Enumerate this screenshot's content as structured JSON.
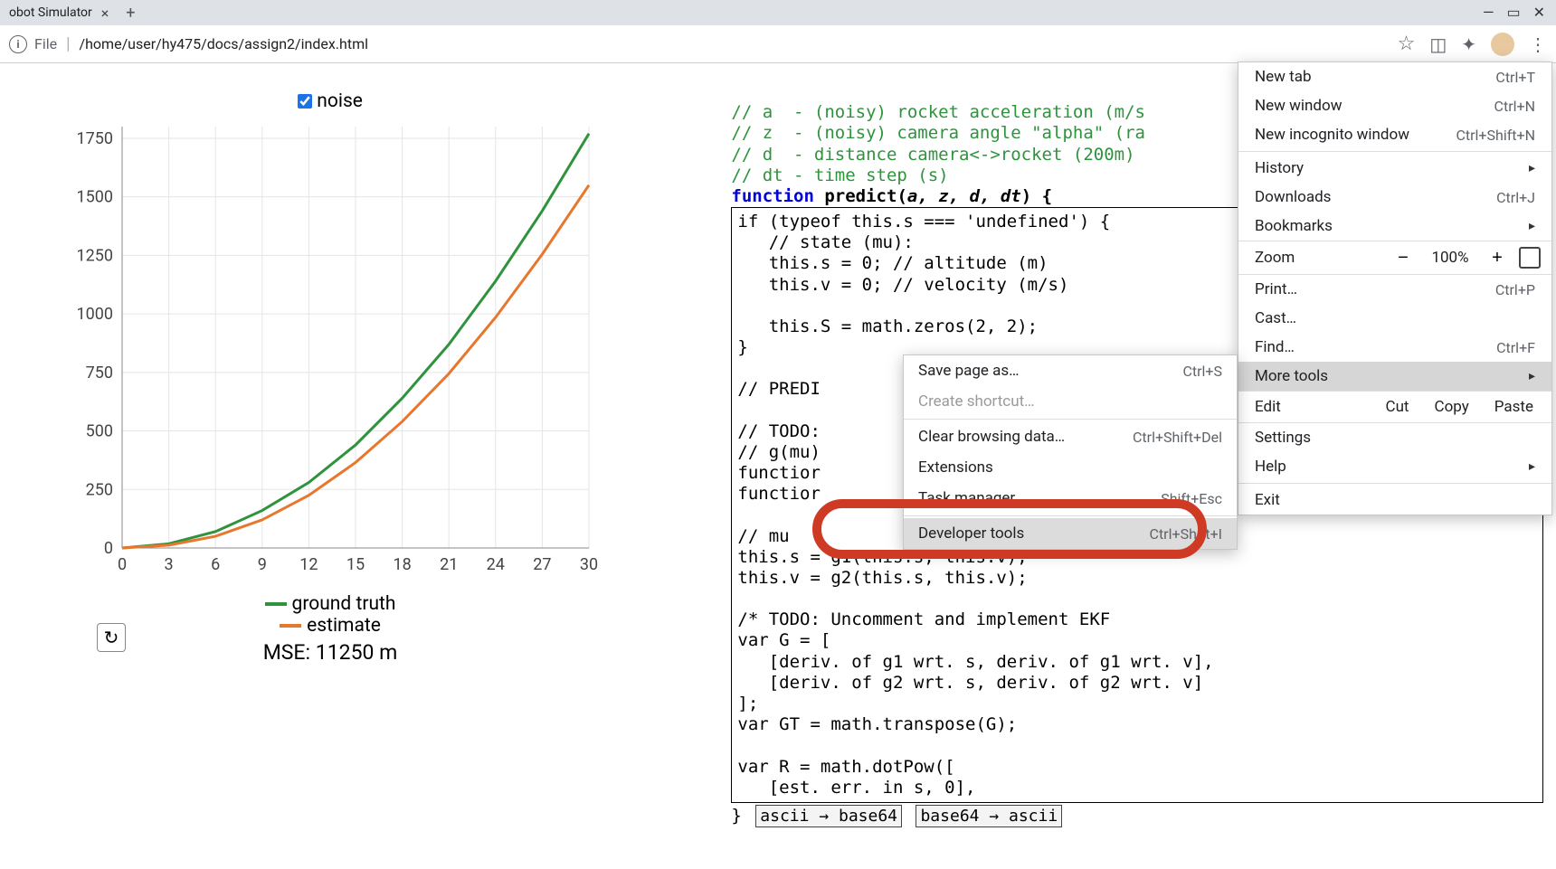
{
  "tab": {
    "title": "obot Simulator"
  },
  "addr": {
    "scheme": "File",
    "path": "/home/user/hy475/docs/assign2/index.html"
  },
  "chart_data": {
    "type": "line",
    "title": "",
    "xlabel": "",
    "ylabel": "",
    "xlim": [
      0,
      30
    ],
    "ylim": [
      0,
      1800
    ],
    "xticks": [
      0,
      3,
      6,
      9,
      12,
      15,
      18,
      21,
      24,
      27,
      30
    ],
    "yticks": [
      0,
      250,
      500,
      750,
      1000,
      1250,
      1500,
      1750
    ],
    "series": [
      {
        "name": "ground truth",
        "color": "#2e933c",
        "x": [
          0,
          3,
          6,
          9,
          12,
          15,
          18,
          21,
          24,
          27,
          30
        ],
        "y": [
          0,
          18,
          70,
          160,
          280,
          440,
          640,
          870,
          1140,
          1440,
          1770
        ]
      },
      {
        "name": "estimate",
        "color": "#e8772e",
        "x": [
          0,
          3,
          6,
          9,
          12,
          15,
          18,
          21,
          24,
          27,
          30
        ],
        "y": [
          0,
          12,
          50,
          120,
          225,
          365,
          540,
          745,
          985,
          1255,
          1550
        ]
      }
    ],
    "toggle_label": "noise",
    "toggle_checked": true,
    "mse_label": "MSE:",
    "mse_value": "11250 m"
  },
  "code_header": [
    "// a  - (noisy) rocket acceleration (m/s",
    "// z  - (noisy) camera angle \"alpha\" (ra",
    "// d  - distance camera<->rocket (200m)",
    "// dt - time step (s)"
  ],
  "code_sig": {
    "kw": "function",
    "name": "predict",
    "args": "a, z, d, dt"
  },
  "code_body": "if (typeof this.s === 'undefined') {\n   // state (mu):\n   this.s = 0; // altitude (m)\n   this.v = 0; // velocity (m/s)\n\n   this.S = math.zeros(2, 2);\n}\n\n// PREDI\n\n// TODO:\n// g(mu)\nfunctior\nfunctior\n\n// mu\nthis.s = g1(this.s, this.v);\nthis.v = g2(this.s, this.v);\n\n/* TODO: Uncomment and implement EKF\nvar G = [\n   [deriv. of g1 wrt. s, deriv. of g1 wrt. v],\n   [deriv. of g2 wrt. s, deriv. of g2 wrt. v]\n];\nvar GT = math.transpose(G);\n\nvar R = math.dotPow([\n   [est. err. in s, 0],",
  "code_after": {
    "brace": "}",
    "btn1": "ascii → base64",
    "btn2": "base64 → ascii"
  },
  "menu": {
    "new_tab": "New tab",
    "new_tab_k": "Ctrl+T",
    "new_win": "New window",
    "new_win_k": "Ctrl+N",
    "new_inc": "New incognito window",
    "new_inc_k": "Ctrl+Shift+N",
    "history": "History",
    "downloads": "Downloads",
    "downloads_k": "Ctrl+J",
    "bookmarks": "Bookmarks",
    "zoom": "Zoom",
    "zoom_val": "100%",
    "print": "Print…",
    "print_k": "Ctrl+P",
    "cast": "Cast…",
    "find": "Find…",
    "find_k": "Ctrl+F",
    "more_tools": "More tools",
    "edit": "Edit",
    "cut": "Cut",
    "copy": "Copy",
    "paste": "Paste",
    "settings": "Settings",
    "help": "Help",
    "exit": "Exit"
  },
  "submenu": {
    "save_page": "Save page as…",
    "save_page_k": "Ctrl+S",
    "create_shortcut": "Create shortcut…",
    "clear_data": "Clear browsing data…",
    "clear_data_k": "Ctrl+Shift+Del",
    "extensions": "Extensions",
    "task_mgr": "Task manager",
    "task_mgr_k": "Shift+Esc",
    "dev_tools": "Developer tools",
    "dev_tools_k": "Ctrl+Shift+I"
  }
}
